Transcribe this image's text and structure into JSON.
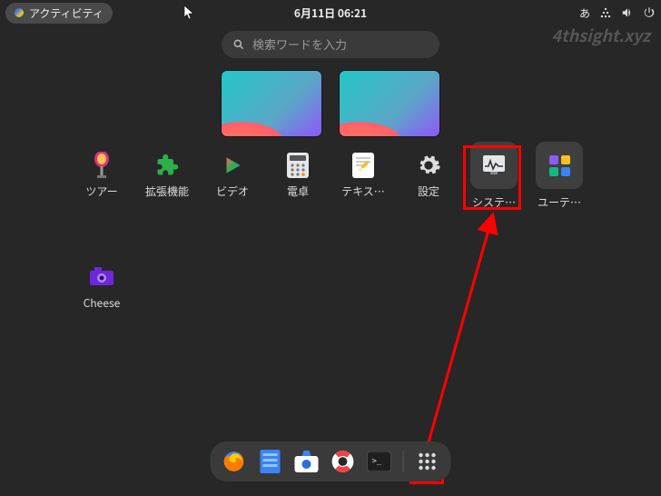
{
  "topbar": {
    "activities_label": "アクティビティ",
    "datetime": "6月11日 06:21",
    "ime": "あ"
  },
  "search": {
    "placeholder": "検索ワードを入力"
  },
  "apps_row1": [
    {
      "label": "ツアー",
      "id": "tour"
    },
    {
      "label": "拡張機能",
      "id": "extensions"
    },
    {
      "label": "ビデオ",
      "id": "videos"
    },
    {
      "label": "電卓",
      "id": "calculator"
    },
    {
      "label": "テキス…",
      "id": "text-editor"
    },
    {
      "label": "設定",
      "id": "settings"
    },
    {
      "label": "システ…",
      "id": "system-monitor"
    },
    {
      "label": "ユーテ…",
      "id": "utilities"
    }
  ],
  "apps_row2": [
    {
      "label": "Cheese",
      "id": "cheese"
    }
  ],
  "dock": [
    {
      "id": "firefox"
    },
    {
      "id": "files"
    },
    {
      "id": "software"
    },
    {
      "id": "help"
    },
    {
      "id": "terminal"
    },
    {
      "id": "show-apps"
    }
  ],
  "watermark": "4thsight.xyz"
}
